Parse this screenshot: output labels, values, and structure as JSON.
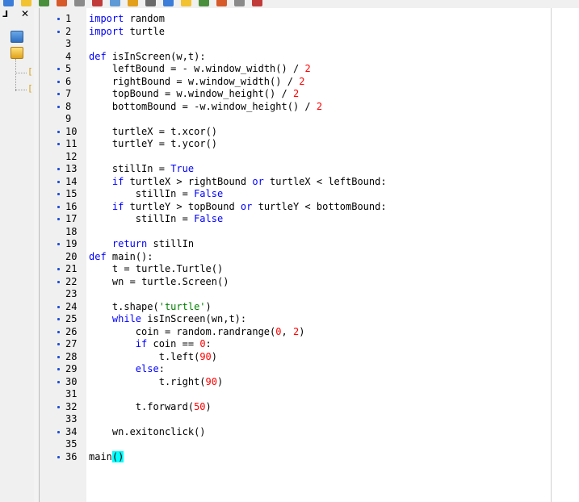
{
  "toolbar": {
    "icons": [
      "new-file-icon",
      "open-file-icon",
      "save-icon",
      "save-all-icon",
      "cut-icon",
      "copy-icon",
      "paste-icon",
      "undo-icon",
      "redo-icon",
      "run-icon",
      "stop-icon",
      "debug-icon",
      "step-icon",
      "settings-icon",
      "help-icon"
    ]
  },
  "side_panel": {
    "pin_glyph": "⅃",
    "close_glyph": "✕",
    "tree_leaves": [
      "[",
      "["
    ]
  },
  "colors": {
    "keyword": "#0000ff",
    "string": "#008000",
    "number": "#ff0000",
    "bracket_highlight": "#00ffff",
    "breakpoint_dot": "#1f4fd8"
  },
  "editor": {
    "lines": [
      {
        "n": "1",
        "bp": true,
        "text": "import random"
      },
      {
        "n": "2",
        "bp": true,
        "text": "import turtle"
      },
      {
        "n": "3",
        "bp": false,
        "text": ""
      },
      {
        "n": "4",
        "bp": false,
        "text": "def isInScreen(w,t):"
      },
      {
        "n": "5",
        "bp": true,
        "text": "    leftBound = - w.window_width() / 2"
      },
      {
        "n": "6",
        "bp": true,
        "text": "    rightBound = w.window_width() / 2"
      },
      {
        "n": "7",
        "bp": true,
        "text": "    topBound = w.window_height() / 2"
      },
      {
        "n": "8",
        "bp": true,
        "text": "    bottomBound = -w.window_height() / 2"
      },
      {
        "n": "9",
        "bp": false,
        "text": ""
      },
      {
        "n": "10",
        "bp": true,
        "text": "    turtleX = t.xcor()"
      },
      {
        "n": "11",
        "bp": true,
        "text": "    turtleY = t.ycor()"
      },
      {
        "n": "12",
        "bp": false,
        "text": ""
      },
      {
        "n": "13",
        "bp": true,
        "text": "    stillIn = True"
      },
      {
        "n": "14",
        "bp": true,
        "text": "    if turtleX > rightBound or turtleX < leftBound:"
      },
      {
        "n": "15",
        "bp": true,
        "text": "        stillIn = False"
      },
      {
        "n": "16",
        "bp": true,
        "text": "    if turtleY > topBound or turtleY < bottomBound:"
      },
      {
        "n": "17",
        "bp": true,
        "text": "        stillIn = False"
      },
      {
        "n": "18",
        "bp": false,
        "text": ""
      },
      {
        "n": "19",
        "bp": true,
        "text": "    return stillIn"
      },
      {
        "n": "20",
        "bp": false,
        "text": "def main():"
      },
      {
        "n": "21",
        "bp": true,
        "text": "    t = turtle.Turtle()"
      },
      {
        "n": "22",
        "bp": true,
        "text": "    wn = turtle.Screen()"
      },
      {
        "n": "23",
        "bp": false,
        "text": ""
      },
      {
        "n": "24",
        "bp": true,
        "text": "    t.shape('turtle')"
      },
      {
        "n": "25",
        "bp": true,
        "text": "    while isInScreen(wn,t):"
      },
      {
        "n": "26",
        "bp": true,
        "text": "        coin = random.randrange(0, 2)"
      },
      {
        "n": "27",
        "bp": true,
        "text": "        if coin == 0:"
      },
      {
        "n": "28",
        "bp": true,
        "text": "            t.left(90)"
      },
      {
        "n": "29",
        "bp": true,
        "text": "        else:"
      },
      {
        "n": "30",
        "bp": true,
        "text": "            t.right(90)"
      },
      {
        "n": "31",
        "bp": false,
        "text": ""
      },
      {
        "n": "32",
        "bp": true,
        "text": "        t.forward(50)"
      },
      {
        "n": "33",
        "bp": false,
        "text": ""
      },
      {
        "n": "34",
        "bp": true,
        "text": "    wn.exitonclick()"
      },
      {
        "n": "35",
        "bp": false,
        "text": ""
      },
      {
        "n": "36",
        "bp": true,
        "text": "main()"
      }
    ]
  }
}
